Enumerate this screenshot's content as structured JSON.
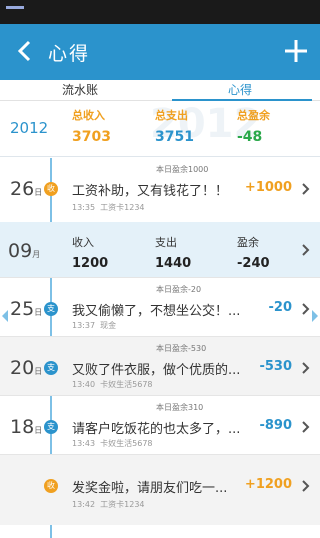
{
  "header": {
    "title": "心得"
  },
  "tabs": [
    {
      "label": "流水账"
    },
    {
      "label": "心得"
    }
  ],
  "summary": {
    "year": "2012",
    "watermark": "2012",
    "income_label": "总收入",
    "income": "3703",
    "expense_label": "总支出",
    "expense": "3751",
    "balance_label": "总盈余",
    "balance": "-48"
  },
  "entries": [
    {
      "day": "26",
      "day_unit": "日",
      "badge": "收",
      "memo": "工资补助，又有钱花了！！",
      "time": "13:35",
      "account": "工资卡1234",
      "amount": "+1000",
      "day_total": "本日盈余1000"
    },
    {
      "day": "25",
      "day_unit": "日",
      "badge": "支",
      "memo": "我又偷懒了，不想坐公交！...",
      "time": "13:37",
      "account": "现金",
      "amount": "-20",
      "day_total": "本日盈余-20"
    },
    {
      "day": "20",
      "day_unit": "日",
      "badge": "支",
      "memo": "又败了件衣服，做个优质的...",
      "time": "13:40",
      "account": "卡奴生活5678",
      "amount": "-530",
      "day_total": "本日盈余-530"
    },
    {
      "day": "18",
      "day_unit": "日",
      "badge": "支",
      "memo": "请客户吃饭花的也太多了，...",
      "time": "13:43",
      "account": "卡奴生活5678",
      "amount": "-890",
      "day_total": "本日盈余310"
    },
    {
      "day": "",
      "day_unit": "",
      "badge": "收",
      "memo": "发奖金啦，请朋友们吃一...",
      "time": "13:42",
      "account": "工资卡1234",
      "amount": "+1200",
      "day_total": ""
    }
  ],
  "month": {
    "num": "09",
    "unit": "月",
    "income_label": "收入",
    "income": "1200",
    "expense_label": "支出",
    "expense": "1440",
    "balance_label": "盈余",
    "balance": "-240"
  },
  "colors": {
    "accent": "#2b93cc",
    "income": "#f0a020",
    "month_bg": "#e4f1f9"
  }
}
